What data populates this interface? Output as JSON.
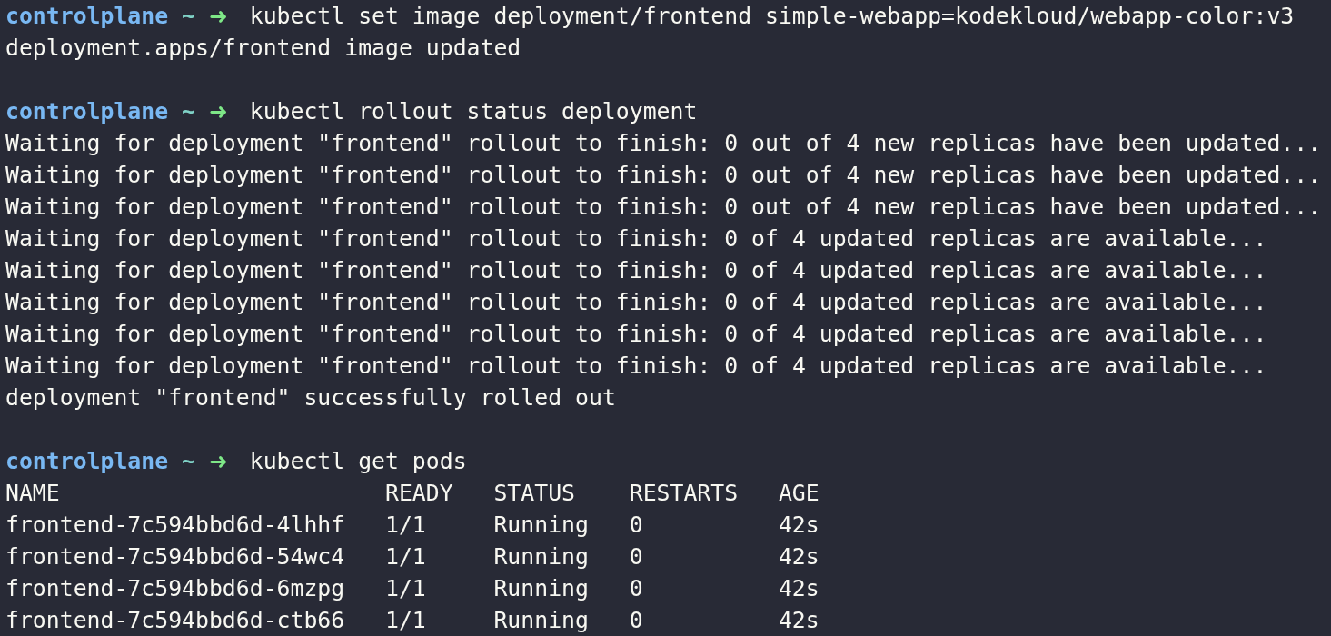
{
  "terminal": {
    "lines": [
      {
        "kind": "prompt",
        "host": "controlplane",
        "dir": "~",
        "arrow": "➜",
        "command": "kubectl set image deployment/frontend simple-webapp=kodekloud/webapp-color:v3"
      },
      {
        "kind": "output",
        "text": "deployment.apps/frontend image updated"
      },
      {
        "kind": "blank"
      },
      {
        "kind": "prompt",
        "host": "controlplane",
        "dir": "~",
        "arrow": "➜",
        "command": "kubectl rollout status deployment"
      },
      {
        "kind": "output",
        "text": "Waiting for deployment \"frontend\" rollout to finish: 0 out of 4 new replicas have been updated..."
      },
      {
        "kind": "output",
        "text": "Waiting for deployment \"frontend\" rollout to finish: 0 out of 4 new replicas have been updated..."
      },
      {
        "kind": "output",
        "text": "Waiting for deployment \"frontend\" rollout to finish: 0 out of 4 new replicas have been updated..."
      },
      {
        "kind": "output",
        "text": "Waiting for deployment \"frontend\" rollout to finish: 0 of 4 updated replicas are available..."
      },
      {
        "kind": "output",
        "text": "Waiting for deployment \"frontend\" rollout to finish: 0 of 4 updated replicas are available..."
      },
      {
        "kind": "output",
        "text": "Waiting for deployment \"frontend\" rollout to finish: 0 of 4 updated replicas are available..."
      },
      {
        "kind": "output",
        "text": "Waiting for deployment \"frontend\" rollout to finish: 0 of 4 updated replicas are available..."
      },
      {
        "kind": "output",
        "text": "Waiting for deployment \"frontend\" rollout to finish: 0 of 4 updated replicas are available..."
      },
      {
        "kind": "output",
        "text": "deployment \"frontend\" successfully rolled out"
      },
      {
        "kind": "blank"
      },
      {
        "kind": "prompt",
        "host": "controlplane",
        "dir": "~",
        "arrow": "➜",
        "command": "kubectl get pods"
      },
      {
        "kind": "table",
        "columns": [
          "NAME",
          "READY",
          "STATUS",
          "RESTARTS",
          "AGE"
        ],
        "rows": [
          [
            "frontend-7c594bbd6d-4lhhf",
            "1/1",
            "Running",
            "0",
            "42s"
          ],
          [
            "frontend-7c594bbd6d-54wc4",
            "1/1",
            "Running",
            "0",
            "42s"
          ],
          [
            "frontend-7c594bbd6d-6mzpg",
            "1/1",
            "Running",
            "0",
            "42s"
          ],
          [
            "frontend-7c594bbd6d-ctb66",
            "1/1",
            "Running",
            "0",
            "42s"
          ]
        ]
      }
    ]
  }
}
